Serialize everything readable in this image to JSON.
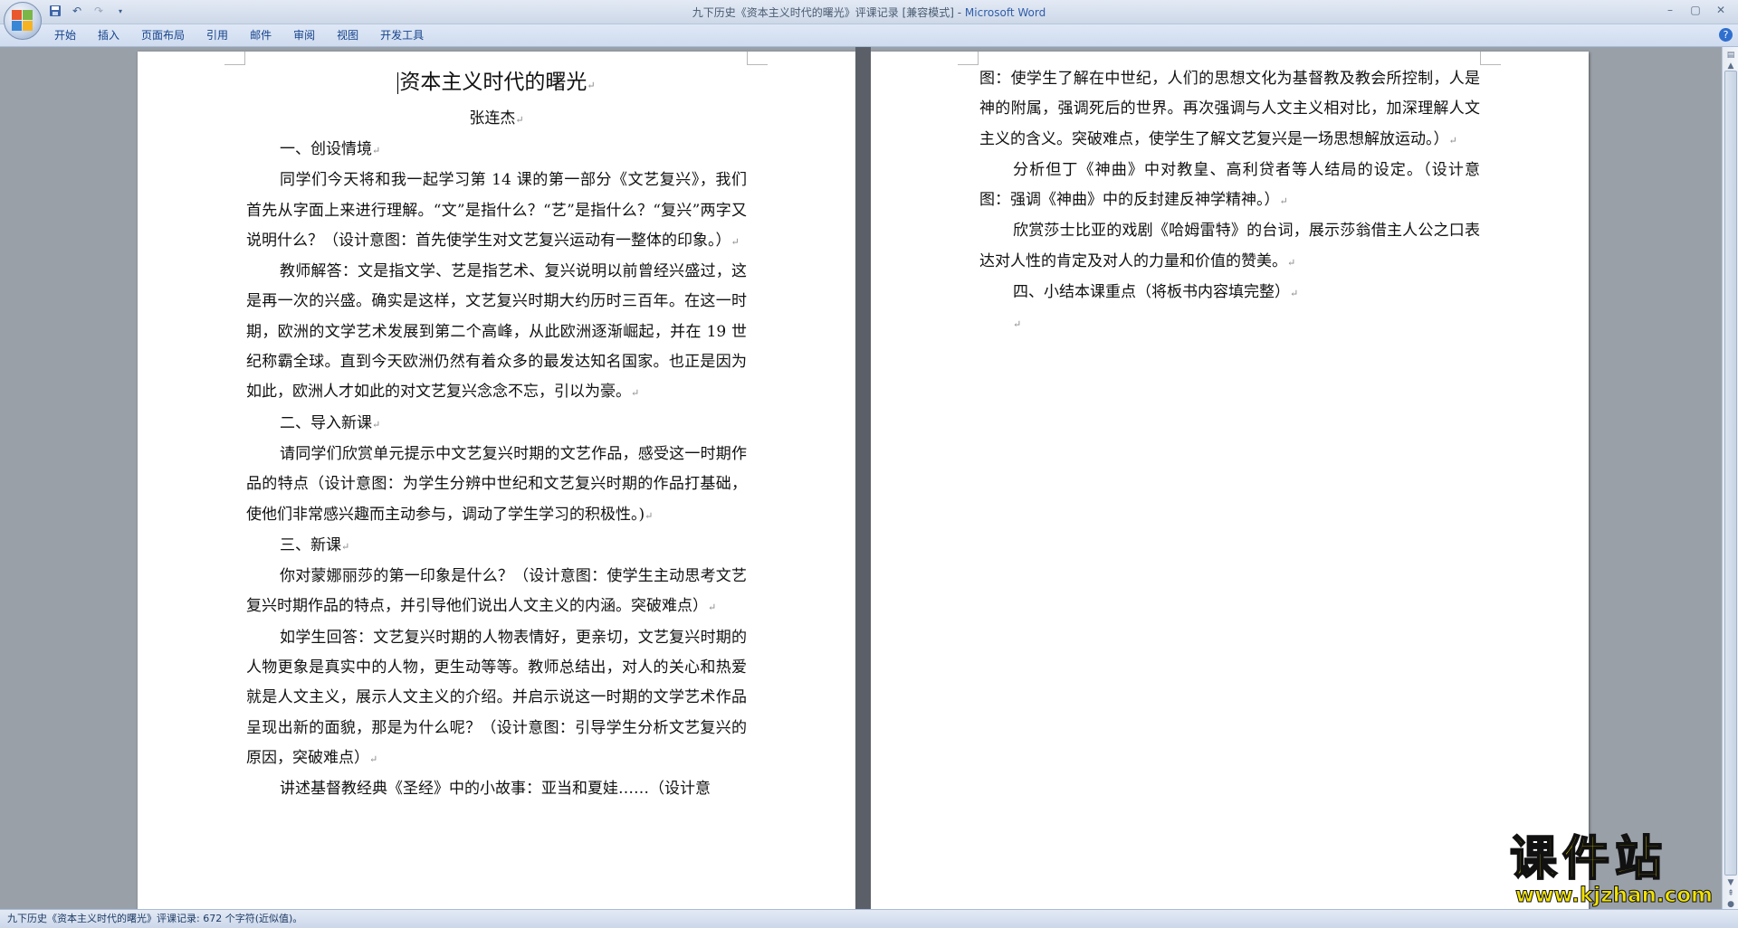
{
  "window": {
    "title_prefix": "九下历史《资本主义时代的曙光》评课记录 [兼容模式] - ",
    "app_name": "Microsoft Word"
  },
  "ribbon": {
    "tabs": [
      "开始",
      "插入",
      "页面布局",
      "引用",
      "邮件",
      "审阅",
      "视图",
      "开发工具"
    ]
  },
  "document": {
    "title": "资本主义时代的曙光",
    "author": "张连杰",
    "page1": [
      {
        "type": "h",
        "text": "一、创设情境"
      },
      {
        "type": "p",
        "text": "同学们今天将和我一起学习第 14 课的第一部分《文艺复兴》，我们首先从字面上来进行理解。“文”是指什么？“艺”是指什么？“复兴”两字又说明什么？（设计意图：首先使学生对文艺复兴运动有一整体的印象。）"
      },
      {
        "type": "p",
        "text": "教师解答：文是指文学、艺是指艺术、复兴说明以前曾经兴盛过，这是再一次的兴盛。确实是这样，文艺复兴时期大约历时三百年。在这一时期，欧洲的文学艺术发展到第二个高峰，从此欧洲逐渐崛起，并在 19 世纪称霸全球。直到今天欧洲仍然有着众多的最发达知名国家。也正是因为如此，欧洲人才如此的对文艺复兴念念不忘，引以为豪。"
      },
      {
        "type": "h",
        "text": "二、导入新课"
      },
      {
        "type": "p",
        "text": "请同学们欣赏单元提示中文艺复兴时期的文艺作品，感受这一时期作品的特点（设计意图：为学生分辨中世纪和文艺复兴时期的作品打基础，使他们非常感兴趣而主动参与，调动了学生学习的积极性。)"
      },
      {
        "type": "h",
        "text": "三、新课"
      },
      {
        "type": "p",
        "text": "你对蒙娜丽莎的第一印象是什么？（设计意图：使学生主动思考文艺复兴时期作品的特点，并引导他们说出人文主义的内涵。突破难点）"
      },
      {
        "type": "p",
        "text": "如学生回答：文艺复兴时期的人物表情好，更亲切，文艺复兴时期的人物更象是真实中的人物，更生动等等。教师总结出，对人的关心和热爱就是人文主义，展示人文主义的介绍。并启示说这一时期的文学艺术作品呈现出新的面貌，那是为什么呢？（设计意图：引导学生分析文艺复兴的原因，突破难点）"
      },
      {
        "type": "p",
        "text": "讲述基督教经典《圣经》中的小故事：亚当和夏娃……（设计意"
      }
    ],
    "page2": [
      {
        "type": "c",
        "text": "图：使学生了解在中世纪，人们的思想文化为基督教及教会所控制，人是神的附属，强调死后的世界。再次强调与人文主义相对比，加深理解人文主义的含义。突破难点，使学生了解文艺复兴是一场思想解放运动。）"
      },
      {
        "type": "p",
        "text": "分析但丁《神曲》中对教皇、高利贷者等人结局的设定。（设计意图：强调《神曲》中的反封建反神学精神。）"
      },
      {
        "type": "p",
        "text": "欣赏莎士比亚的戏剧《哈姆雷特》的台词，展示莎翁借主人公之口表达对人性的肯定及对人的力量和价值的赞美。"
      },
      {
        "type": "h",
        "text": "四、小结本课重点（将板书内容填完整）"
      },
      {
        "type": "h",
        "text": ""
      }
    ]
  },
  "statusbar": {
    "text": "九下历史《资本主义时代的曙光》评课记录: 672 个字符(近似值)。"
  },
  "watermark": {
    "brand": "课件站",
    "url": "www.kjzhan.com"
  },
  "colors": {
    "watermark_fill": "#f2e300",
    "app_name": "#2f5da8"
  }
}
